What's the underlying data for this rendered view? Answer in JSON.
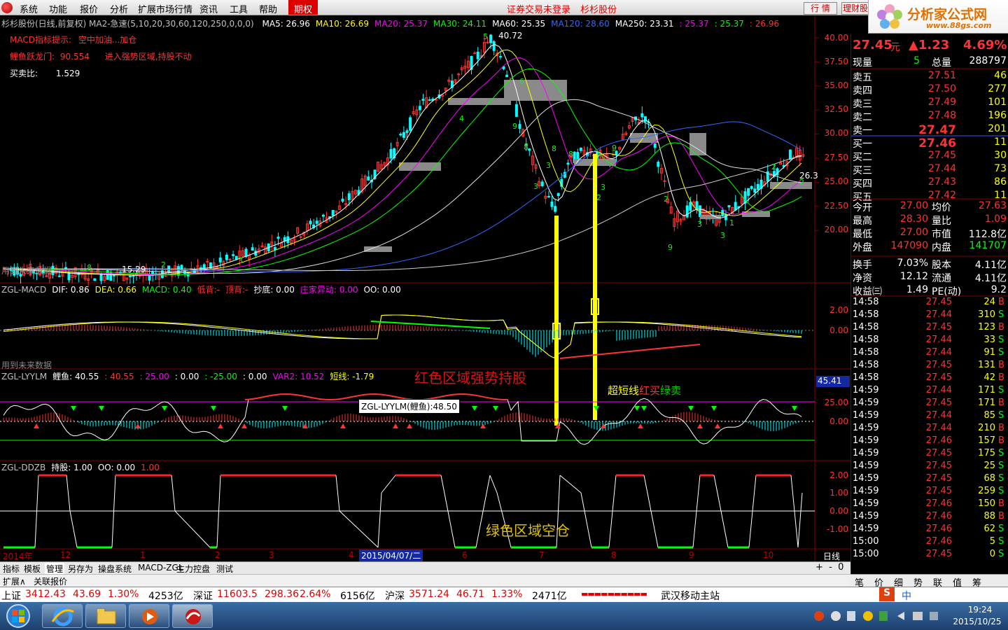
{
  "menu": {
    "items": [
      "系统",
      "功能",
      "报价",
      "分析",
      "扩展市场行情",
      "资讯",
      "工具",
      "帮助"
    ],
    "options_label": "期权",
    "security_status": "证券交易未登录",
    "security_name": "杉杉股份",
    "quote_button": "行 情",
    "finance_button": "理财股"
  },
  "brand": {
    "name": "分析家公式网",
    "url": "www.88gs.com"
  },
  "colors": {
    "up": "#ff3333",
    "down": "#00cc00",
    "accent": "#ffff00",
    "panel_border": "#800000"
  },
  "chart": {
    "title": "杉杉股份(日线,前复权)",
    "ma_label": "MA2-急速(5,10,20,30,60,120,250,0,0,0)",
    "ma_values": [
      {
        "label": "MA5: 26.96",
        "color": "#ffffff"
      },
      {
        "label": "MA10: 26.69",
        "color": "#ffff00"
      },
      {
        "label": "MA20: 25.37",
        "color": "#ff00ff"
      },
      {
        "label": "MA30: 24.11",
        "color": "#00ff00"
      },
      {
        "label": "MA60: 25.35",
        "color": "#ffffff"
      },
      {
        "label": "MA120: 28.60",
        "color": "#3366ff"
      },
      {
        "label": "MA250: 23.31",
        "color": "#ffffff"
      },
      {
        "label": ": 25.37",
        "color": "#ff00ff"
      },
      {
        "label": ": 25.37",
        "color": "#00ff00"
      },
      {
        "label": ": 26.96",
        "color": "#ff3333"
      }
    ],
    "macd_hint_label": "MACD指标提示:",
    "macd_hint_value": "空中加油...加仓",
    "carp_label": "鲤鱼跃龙门:",
    "carp_value": "90.554",
    "carp_note": "进入强势区域,持股不动",
    "buysell_label": "买卖比:",
    "buysell_value": "1.529",
    "high_marker": "40.72",
    "low_marker": "15.29",
    "last_price_marker": "26.3",
    "future_data_note": "用到未来数据",
    "price_axis": [
      "40.00",
      "37.50",
      "35.00",
      "32.50",
      "30.00",
      "27.50",
      "25.00",
      "22.50",
      "20.00"
    ],
    "wave_labels": [
      "5",
      "8",
      "4",
      "9",
      "2",
      "6",
      "3",
      "8",
      "9",
      "2",
      "3",
      "3",
      "1",
      "8",
      "3",
      "3",
      "9",
      "2",
      "2",
      "8",
      "3",
      "2"
    ],
    "macd_panel": {
      "header": [
        {
          "t": "ZGL-MACD",
          "c": "#c0c0c0"
        },
        {
          "t": "DIF: 0.86",
          "c": "#ffffff"
        },
        {
          "t": "DEA: 0.66",
          "c": "#ffff00"
        },
        {
          "t": "MACD: 0.40",
          "c": "#00ff00"
        },
        {
          "t": "低背:-",
          "c": "#ff3333"
        },
        {
          "t": "顶背:-",
          "c": "#ff3333"
        },
        {
          "t": "抄底: 0.00",
          "c": "#ffffff"
        },
        {
          "t": "庄家异动: 0.00",
          "c": "#ff00ff"
        },
        {
          "t": "OO: 0.00",
          "c": "#ffffff"
        }
      ],
      "axis": [
        "2.00",
        "0.00"
      ]
    },
    "lyylm_panel": {
      "header": [
        {
          "t": "ZGL-LYYLM",
          "c": "#c0c0c0"
        },
        {
          "t": "鲤鱼: 40.55",
          "c": "#ffffff"
        },
        {
          "t": ": 40.55",
          "c": "#ff3333"
        },
        {
          "t": ": 25.00",
          "c": "#ff00ff"
        },
        {
          "t": ": 0.00",
          "c": "#ffffff"
        },
        {
          "t": ": -25.00",
          "c": "#00ff00"
        },
        {
          "t": ": 0.00",
          "c": "#ffffff"
        },
        {
          "t": "VAR2: 10.52",
          "c": "#ff00ff"
        },
        {
          "t": "短线: -1.79",
          "c": "#ffff00"
        }
      ],
      "axis": [
        "25.00",
        "0.00"
      ],
      "value_box": "45.41",
      "tooltip": "ZGL-LYYLM(鲤鱼):48.50"
    },
    "ddzb_panel": {
      "header": [
        {
          "t": "ZGL-DDZB",
          "c": "#c0c0c0"
        },
        {
          "t": "持股: 1.00",
          "c": "#ffffff"
        },
        {
          "t": "OO: 0.00",
          "c": "#ffffff"
        },
        {
          "t": "1.00",
          "c": "#ff3333"
        }
      ],
      "axis": [
        "2.00",
        "1.00",
        "0.00",
        "-1.00"
      ]
    },
    "annotations": {
      "red_zone": "红色区域强势持股",
      "short_line_prefix": "超短线",
      "short_line_red": "红买",
      "short_line_green": "绿卖",
      "green_zone": "绿色区域空仓"
    },
    "date_axis": {
      "year": "2014年",
      "months": [
        "12",
        "1",
        "2",
        "3",
        "4",
        "6",
        "7",
        "8",
        "9",
        "10"
      ],
      "highlight": "2015/04/07/二",
      "period": "日线"
    }
  },
  "quote": {
    "price": "27.45",
    "unit": "元",
    "change": "▲1.23",
    "pct": "4.69%",
    "now_vol_label": "现量",
    "now_vol": "5",
    "total_vol_label": "总量",
    "total_vol": "288797",
    "asks": [
      {
        "label": "卖五",
        "price": "27.51",
        "vol": "46"
      },
      {
        "label": "卖四",
        "price": "27.50",
        "vol": "277"
      },
      {
        "label": "卖三",
        "price": "27.49",
        "vol": "101"
      },
      {
        "label": "卖二",
        "price": "27.48",
        "vol": "196"
      },
      {
        "label": "卖一",
        "price": "27.47",
        "vol": "201"
      }
    ],
    "bids": [
      {
        "label": "买一",
        "price": "27.46",
        "vol": "11"
      },
      {
        "label": "买二",
        "price": "27.45",
        "vol": "30"
      },
      {
        "label": "买三",
        "price": "27.44",
        "vol": "73"
      },
      {
        "label": "买四",
        "price": "27.43",
        "vol": "86"
      },
      {
        "label": "买五",
        "price": "27.42",
        "vol": "11"
      }
    ],
    "stats": [
      {
        "l1": "今开",
        "v1": "27.00",
        "l2": "均价",
        "v2": "27.63",
        "c1": "#ff3333",
        "c2": "#ff3333"
      },
      {
        "l1": "最高",
        "v1": "28.30",
        "l2": "量比",
        "v2": "1.09",
        "c1": "#ff3333",
        "c2": "#ff3333"
      },
      {
        "l1": "最低",
        "v1": "27.00",
        "l2": "市值",
        "v2": "112.8亿",
        "c1": "#ff3333",
        "c2": "#ffffff"
      },
      {
        "l1": "外盘",
        "v1": "147090",
        "l2": "内盘",
        "v2": "141707",
        "c1": "#ff3333",
        "c2": "#00ff00"
      },
      {
        "l1": "换手",
        "v1": "7.03%",
        "l2": "股本",
        "v2": "4.11亿",
        "c1": "#ffffff",
        "c2": "#ffffff"
      },
      {
        "l1": "净资",
        "v1": "12.12",
        "l2": "流通",
        "v2": "4.11亿",
        "c1": "#ffffff",
        "c2": "#ffffff"
      },
      {
        "l1": "收益㈢",
        "v1": "1.49",
        "l2": "PE(动)",
        "v2": "9.2",
        "c1": "#ffffff",
        "c2": "#ffffff"
      }
    ],
    "trades": [
      {
        "t": "14:58",
        "p": "27.45",
        "v": "24",
        "s": "B"
      },
      {
        "t": "14:58",
        "p": "27.44",
        "v": "310",
        "s": "S"
      },
      {
        "t": "14:58",
        "p": "27.45",
        "v": "123",
        "s": "B"
      },
      {
        "t": "14:58",
        "p": "27.44",
        "v": "33",
        "s": "S"
      },
      {
        "t": "14:58",
        "p": "27.44",
        "v": "91",
        "s": "S"
      },
      {
        "t": "14:58",
        "p": "27.45",
        "v": "131",
        "s": "B"
      },
      {
        "t": "14:58",
        "p": "27.45",
        "v": "42",
        "s": "B"
      },
      {
        "t": "14:59",
        "p": "27.44",
        "v": "171",
        "s": "S"
      },
      {
        "t": "14:59",
        "p": "27.45",
        "v": "171",
        "s": "B"
      },
      {
        "t": "14:59",
        "p": "27.44",
        "v": "85",
        "s": "S"
      },
      {
        "t": "14:59",
        "p": "27.44",
        "v": "210",
        "s": "B"
      },
      {
        "t": "14:59",
        "p": "27.46",
        "v": "157",
        "s": "B"
      },
      {
        "t": "14:59",
        "p": "27.45",
        "v": "175",
        "s": "S"
      },
      {
        "t": "14:59",
        "p": "27.45",
        "v": "25",
        "s": "S"
      },
      {
        "t": "14:59",
        "p": "27.45",
        "v": "68",
        "s": "S"
      },
      {
        "t": "14:59",
        "p": "27.45",
        "v": "259",
        "s": "S"
      },
      {
        "t": "14:59",
        "p": "27.46",
        "v": "150",
        "s": "B"
      },
      {
        "t": "14:59",
        "p": "27.46",
        "v": "88",
        "s": "B"
      },
      {
        "t": "14:59",
        "p": "27.46",
        "v": "62",
        "s": "S"
      },
      {
        "t": "15:00",
        "p": "27.46",
        "v": "5",
        "s": "S"
      },
      {
        "t": "15:00",
        "p": "27.45",
        "v": "0",
        "s": "S"
      }
    ]
  },
  "bottom_tabs": [
    "指标",
    "模板",
    "管理",
    "另存为",
    "操盘系统",
    "MACD-ZGL",
    "主力控盘",
    "测试"
  ],
  "expand_row": [
    "扩展∧",
    "关联报价"
  ],
  "tickbar": [
    "笔",
    "价",
    "细",
    "势",
    "联",
    "值",
    "筹"
  ],
  "status": [
    {
      "name": "上证",
      "val": "3412.43",
      "chg": "43.69",
      "pct": "1.30%",
      "amt": "4253亿"
    },
    {
      "name": "深证",
      "val": "11603.5",
      "chg": "298.36",
      "pct": "2.64%",
      "amt": "6156亿"
    },
    {
      "name": "沪深",
      "val": "3571.24",
      "chg": "46.71",
      "pct": "1.33%",
      "amt": "2471亿"
    }
  ],
  "server": "武汉移动主站",
  "ime": "中",
  "clock": {
    "time": "19:24",
    "date": "2015/10/25"
  }
}
